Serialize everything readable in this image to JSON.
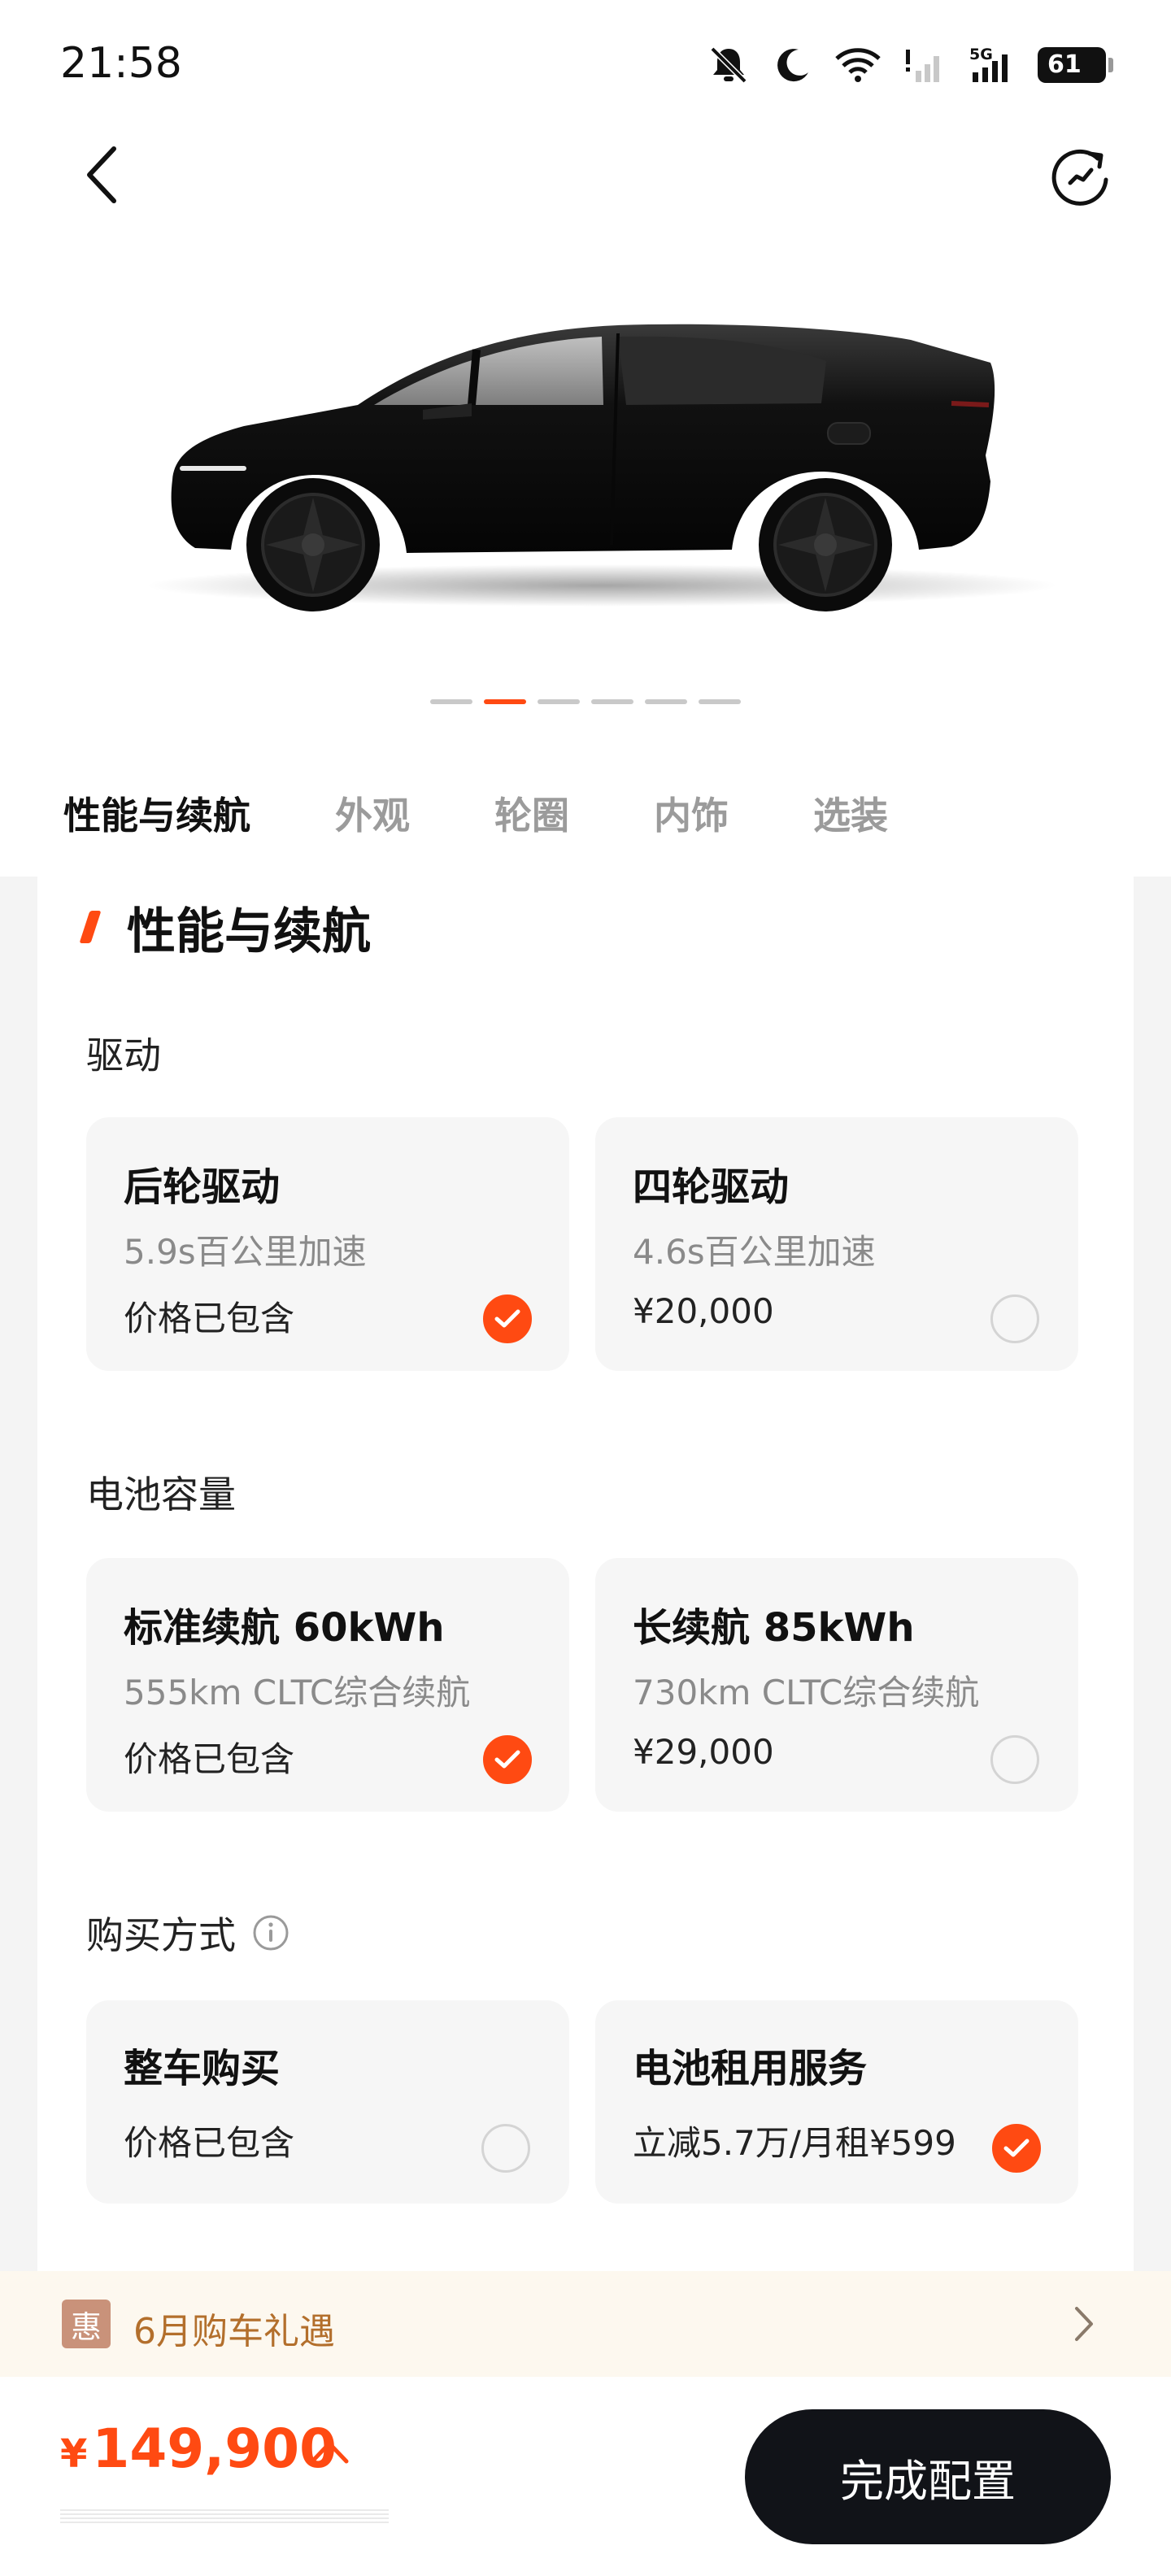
{
  "status_bar": {
    "time": "21:58",
    "network": "5G",
    "battery": "61"
  },
  "colors": {
    "accent": "#ff4a12",
    "dark_button": "#111318",
    "promo_text": "#b36f2c",
    "card_bg": "#f6f6f6"
  },
  "nav": {
    "back_icon": "chevron-left-icon",
    "refresh_icon": "refresh-icon"
  },
  "carousel": {
    "count": 6,
    "active_index": 1
  },
  "tabs": [
    "性能与续航",
    "外观",
    "轮圈",
    "内饰",
    "选装"
  ],
  "section": {
    "title": "性能与续航"
  },
  "drive": {
    "label": "驱动",
    "options": [
      {
        "title": "后轮驱动",
        "subtitle": "5.9s百公里加速",
        "price": "价格已包含",
        "selected": true
      },
      {
        "title": "四轮驱动",
        "subtitle": "4.6s百公里加速",
        "price": "¥20,000",
        "selected": false
      }
    ]
  },
  "battery_capacity": {
    "label": "电池容量",
    "options": [
      {
        "title": "标准续航 60kWh",
        "subtitle": "555km CLTC综合续航",
        "price": "价格已包含",
        "selected": true
      },
      {
        "title": "长续航 85kWh",
        "subtitle": "730km CLTC综合续航",
        "price": "¥29,000",
        "selected": false
      }
    ]
  },
  "purchase": {
    "label": "购买方式",
    "options": [
      {
        "title": "整车购买",
        "price": "价格已包含",
        "selected": false
      },
      {
        "title": "电池租用服务",
        "price": "立减5.7万/月租¥599",
        "selected": true
      }
    ]
  },
  "promo": {
    "badge": "惠",
    "text": "6月购车礼遇"
  },
  "bottom": {
    "currency": "¥",
    "price": "149,900",
    "cta": "完成配置"
  }
}
